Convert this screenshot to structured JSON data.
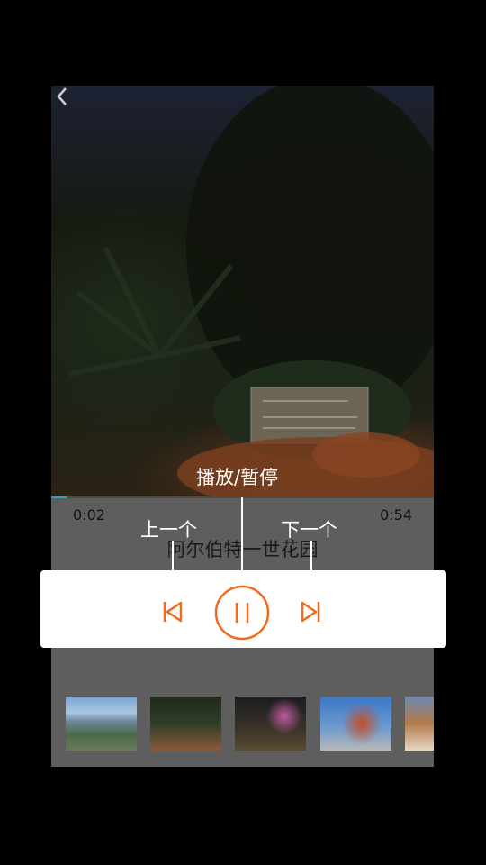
{
  "player": {
    "current_time": "0:02",
    "total_time": "0:54",
    "progress_fraction": 0.04,
    "title": "阿尔伯特一世花园"
  },
  "guide": {
    "play_pause_label": "播放/暂停",
    "prev_label": "上一个",
    "next_label": "下一个"
  },
  "colors": {
    "accent": "#f06a1e",
    "progress": "#2fa6b5"
  },
  "icons": {
    "back": "chevron-left-icon",
    "prev": "skip-previous-icon",
    "pause": "pause-icon",
    "next": "skip-next-icon"
  },
  "thumbnails": [
    {
      "name": "thumbnail-1"
    },
    {
      "name": "thumbnail-2"
    },
    {
      "name": "thumbnail-3"
    },
    {
      "name": "thumbnail-4"
    },
    {
      "name": "thumbnail-5"
    }
  ]
}
